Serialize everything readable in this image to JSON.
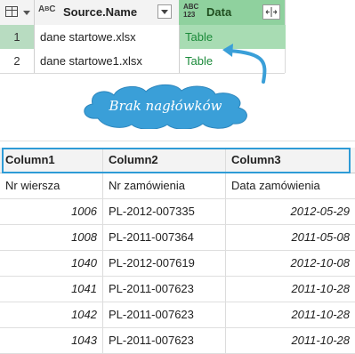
{
  "top_grid": {
    "corner_icon": "table-icon",
    "columns": [
      {
        "type_icon": "ABC",
        "label": "Source.Name"
      },
      {
        "type_icon": "ABC 123",
        "label": "Data"
      }
    ],
    "rows": [
      {
        "num": "1",
        "name": "dane startowe.xlsx",
        "data": "Table"
      },
      {
        "num": "2",
        "name": "dane startowe1.xlsx",
        "data": "Table"
      }
    ]
  },
  "callout": {
    "text": "Brak nagłówków",
    "color": "#3a9fd8"
  },
  "bottom_grid": {
    "headers": [
      "Column1",
      "Column2",
      "Column3"
    ],
    "rows": [
      [
        "Nr wiersza",
        "Nr zamówienia",
        "Data zamówienia"
      ],
      [
        "1006",
        "PL-2012-007335",
        "2012-05-29"
      ],
      [
        "1008",
        "PL-2011-007364",
        "2011-05-08"
      ],
      [
        "1040",
        "PL-2012-007619",
        "2012-10-08"
      ],
      [
        "1041",
        "PL-2011-007623",
        "2011-10-28"
      ],
      [
        "1042",
        "PL-2011-007623",
        "2011-10-28"
      ],
      [
        "1043",
        "PL-2011-007623",
        "2011-10-28"
      ]
    ],
    "highlight_color": "#2e9bd6"
  },
  "colors": {
    "selected_column": "#8fd19e",
    "link_green": "#1b8a3a"
  }
}
